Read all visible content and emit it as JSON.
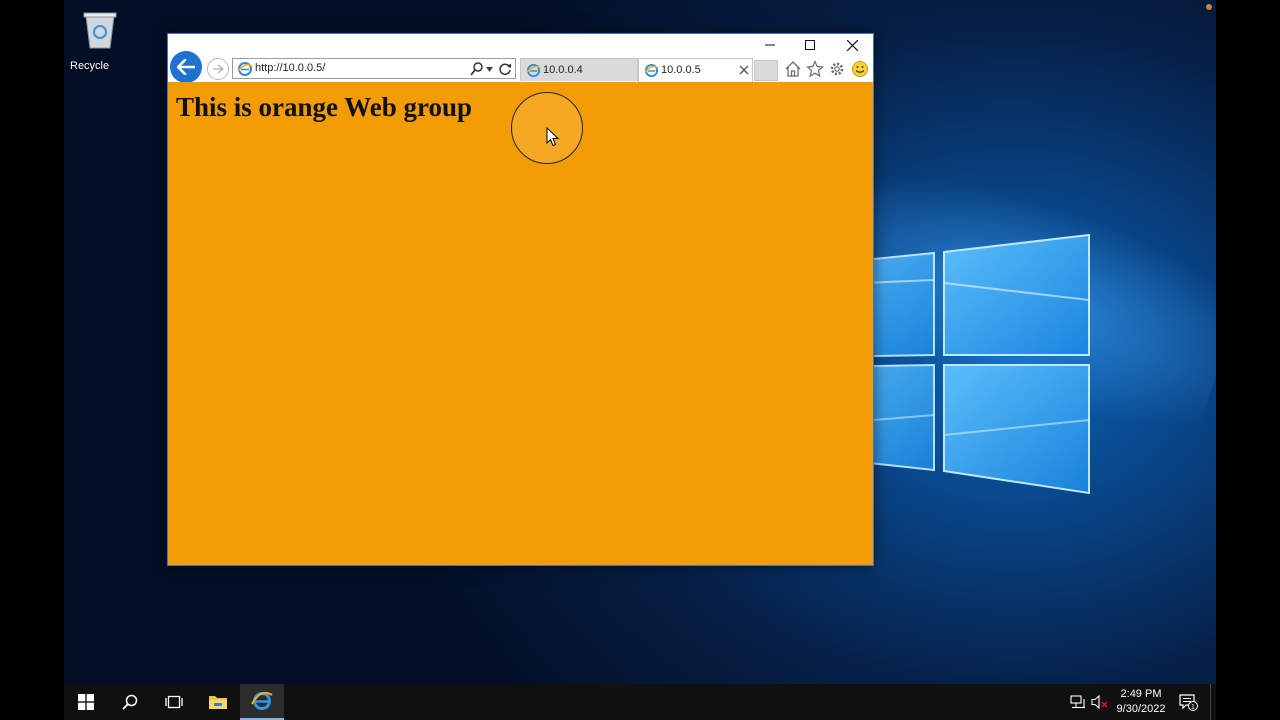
{
  "desktop": {
    "recycle_bin_label": "Recycle"
  },
  "browser": {
    "address_url": "http://10.0.0.5/",
    "tabs": [
      {
        "label": "10.0.0.4",
        "active": false
      },
      {
        "label": "10.0.0.5",
        "active": true
      }
    ],
    "page": {
      "heading": "This is orange Web group",
      "background_color": "#f39c06"
    },
    "icons": {
      "back": "back-arrow-icon",
      "forward": "forward-arrow-icon",
      "search": "search-icon",
      "refresh": "refresh-icon",
      "home": "home-icon",
      "favorites": "star-icon",
      "tools": "gear-icon",
      "feedback": "smiley-icon"
    }
  },
  "taskbar": {
    "time": "2:49 PM",
    "date": "9/30/2022",
    "notification_count": "1"
  },
  "colors": {
    "accent": "#1f72cf",
    "page_orange": "#f39c06",
    "taskbar": "#101010"
  }
}
